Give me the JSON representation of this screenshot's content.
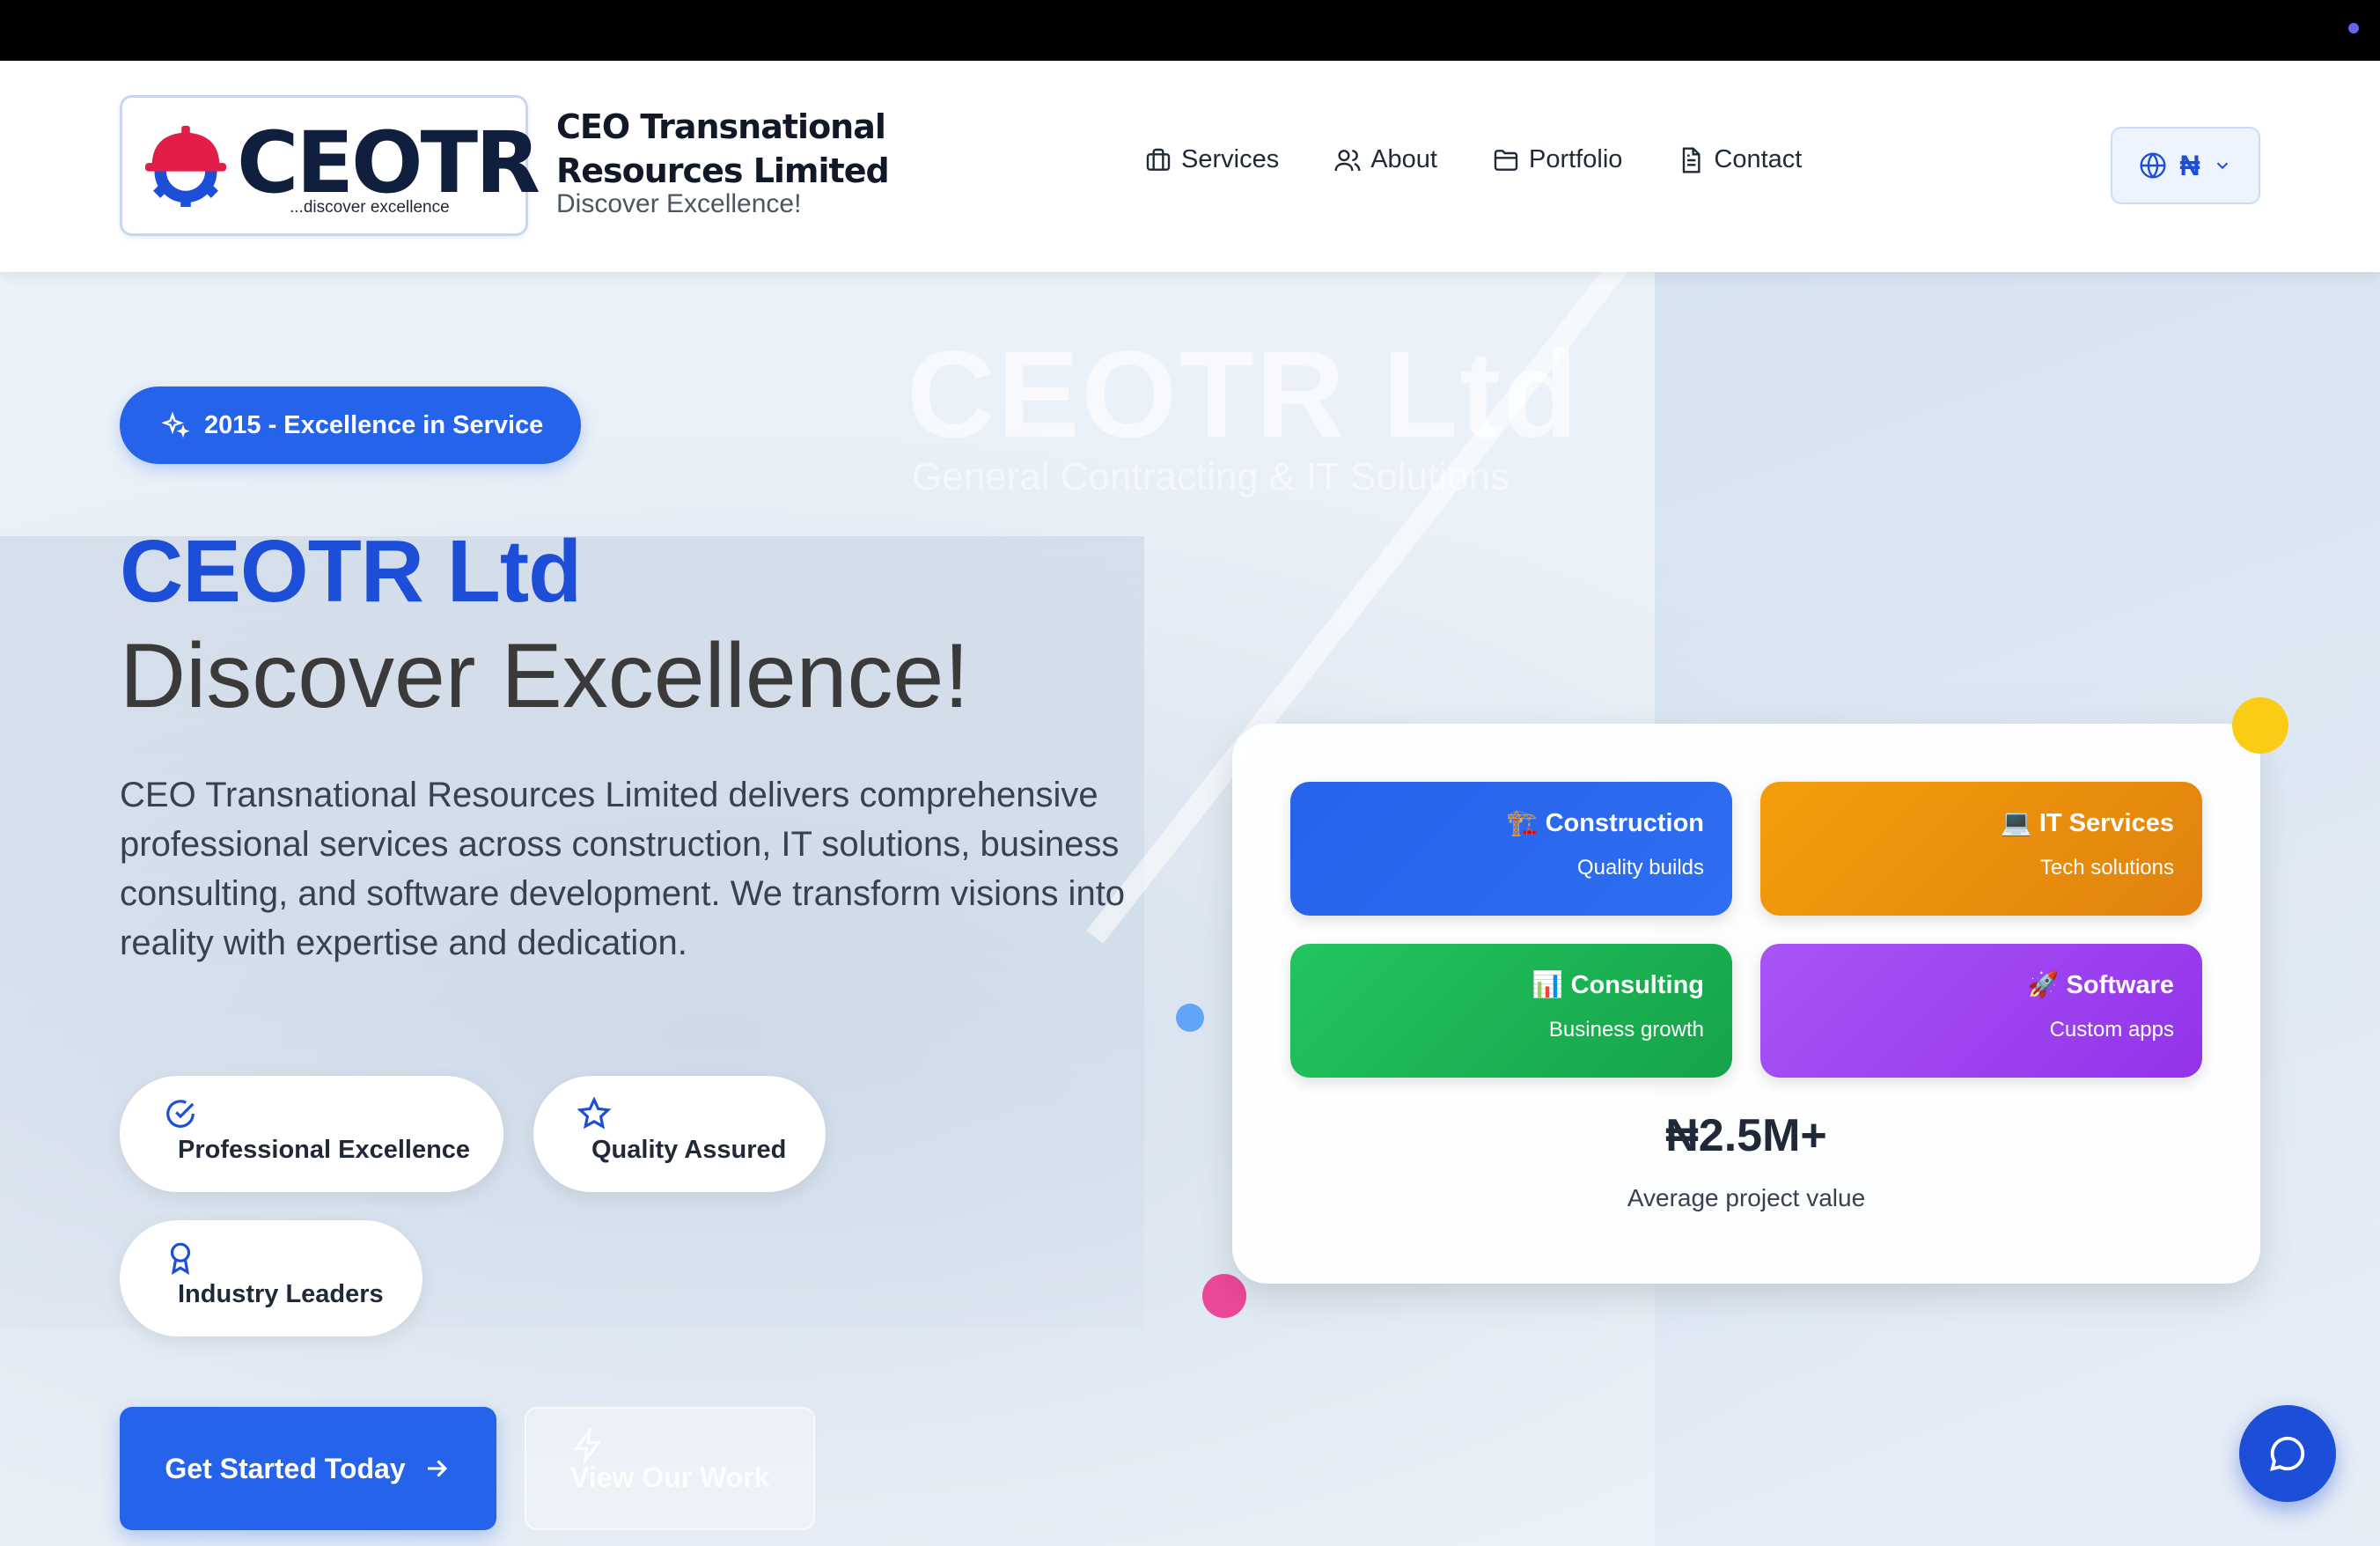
{
  "header": {
    "logo_word": "CEOTR",
    "logo_tagline": "...discover excellence",
    "company_name": "CEO Transnational Resources Limited",
    "company_tagline": "Discover Excellence!",
    "nav": [
      {
        "label": "Services",
        "icon": "briefcase-icon"
      },
      {
        "label": "About",
        "icon": "users-icon"
      },
      {
        "label": "Portfolio",
        "icon": "folder-icon"
      },
      {
        "label": "Contact",
        "icon": "document-icon"
      }
    ],
    "currency_symbol": "₦"
  },
  "hero": {
    "watermark_title": "CEOTR Ltd",
    "watermark_subtitle": "General Contracting & IT Solutions",
    "badge": "2015 - Excellence in Service",
    "title": "CEOTR Ltd",
    "subtitle": "Discover Excellence!",
    "description": "CEO Transnational Resources Limited delivers comprehensive professional services across construction, IT solutions, business consulting, and software development. We transform visions into reality with expertise and dedication.",
    "features": [
      {
        "label": "Professional Excellence",
        "icon": "check-circle-icon"
      },
      {
        "label": "Quality Assured",
        "icon": "star-icon"
      },
      {
        "label": "Industry Leaders",
        "icon": "award-icon"
      }
    ],
    "cta_primary": "Get Started Today",
    "cta_secondary": "View Our Work"
  },
  "card": {
    "tiles": [
      {
        "emoji": "🏗️",
        "title": "Construction",
        "sub": "Quality builds",
        "color": "#2563eb"
      },
      {
        "emoji": "💻",
        "title": "IT Services",
        "sub": "Tech solutions",
        "color": "#f59e0b"
      },
      {
        "emoji": "📊",
        "title": "Consulting",
        "sub": "Business growth",
        "color": "#22c55e"
      },
      {
        "emoji": "🚀",
        "title": "Software",
        "sub": "Custom apps",
        "color": "#a855f7"
      }
    ],
    "stat_value": "₦2.5M+",
    "stat_label": "Average project value"
  },
  "colors": {
    "primary": "#2563eb",
    "accent_yellow": "#facc15",
    "accent_pink": "#ec4899",
    "accent_blue_dot": "#60a5fa"
  }
}
